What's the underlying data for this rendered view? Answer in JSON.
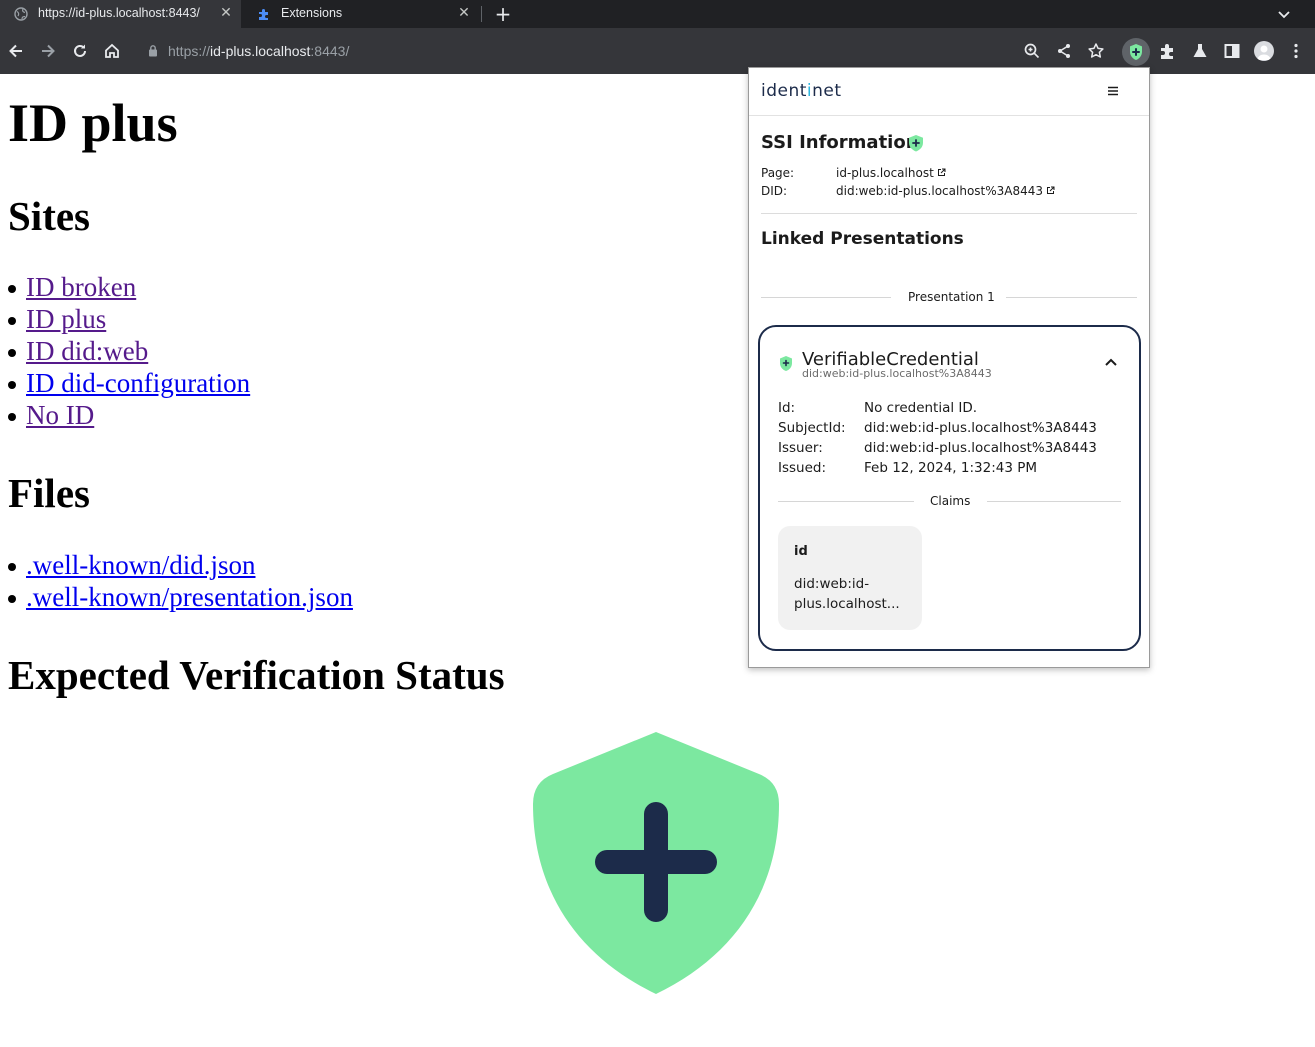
{
  "browser": {
    "tabs": [
      {
        "title": "https://id-plus.localhost:8443/",
        "active": true
      },
      {
        "title": "Extensions",
        "active": false
      }
    ],
    "close_glyph": "✕",
    "new_tab_glyph": "+",
    "url": {
      "scheme": "https://",
      "host": "id-plus.localhost",
      "port": ":8443/"
    },
    "toolbar_icons": [
      "back-icon",
      "forward-icon",
      "reload-icon",
      "home-icon",
      "lock-icon",
      "zoom-icon",
      "share-icon",
      "bookmark-star-icon",
      "identinet-extension-icon",
      "extensions-puzzle-icon",
      "labs-flask-icon",
      "side-panel-icon",
      "profile-avatar",
      "kebab-menu-icon"
    ]
  },
  "page": {
    "title": "ID plus",
    "sites_heading": "Sites",
    "sites": [
      {
        "label": "ID broken",
        "visited": true
      },
      {
        "label": "ID plus",
        "visited": true
      },
      {
        "label": "ID did:web",
        "visited": true
      },
      {
        "label": "ID did-configuration",
        "visited": false
      },
      {
        "label": "No ID",
        "visited": true
      }
    ],
    "files_heading": "Files",
    "files": [
      {
        "label": ".well-known/did.json",
        "visited": false
      },
      {
        "label": ".well-known/presentation.json",
        "visited": false
      }
    ],
    "status_heading": "Expected Verification Status",
    "status_icon": "shield-plus-icon"
  },
  "popup": {
    "brand": {
      "before": "ident",
      "mid": "i",
      "after": "net"
    },
    "ssi_title": "SSI Information",
    "page_label": "Page:",
    "page_value": "id-plus.localhost",
    "did_label": "DID:",
    "did_value": "did:web:id-plus.localhost%3A8443",
    "linked_title": "Linked Presentations",
    "presentation_label": "Presentation 1",
    "credential": {
      "title": "VerifiableCredential",
      "subtitle": "did:web:id-plus.localhost%3A8443",
      "id_label": "Id:",
      "id_value": "No credential ID.",
      "subject_label": "SubjectId:",
      "subject_value": "did:web:id-plus.localhost%3A8443",
      "issuer_label": "Issuer:",
      "issuer_value": "did:web:id-plus.localhost%3A8443",
      "issued_label": "Issued:",
      "issued_value": "Feb 12, 2024, 1:32:43 PM",
      "claims_label": "Claims",
      "claim_key": "id",
      "claim_value": "did:web:id-plus.localhost..."
    }
  },
  "colors": {
    "shield_green": "#7ce8a0",
    "navy": "#1c2b4a",
    "link_visited": "#551a8b",
    "link_unvisited": "#0000ee",
    "chrome_dark": "#202124",
    "chrome_toolbar": "#35363a"
  }
}
